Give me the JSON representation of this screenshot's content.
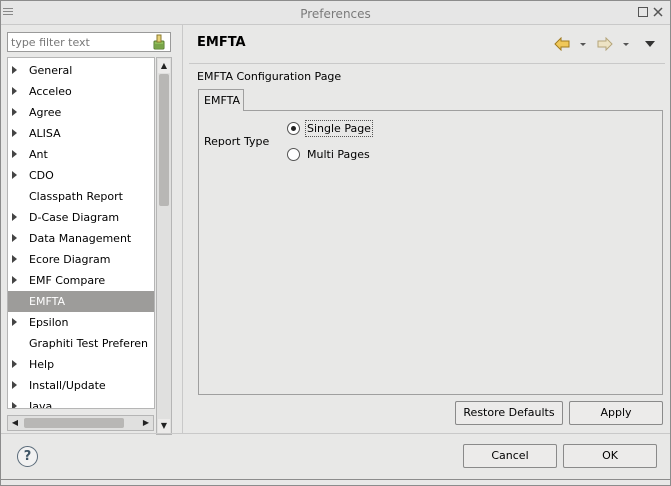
{
  "window": {
    "title": "Preferences"
  },
  "filter": {
    "placeholder": "type filter text"
  },
  "tree": {
    "items": [
      {
        "label": "General",
        "expandable": true
      },
      {
        "label": "Acceleo",
        "expandable": true
      },
      {
        "label": "Agree",
        "expandable": true
      },
      {
        "label": "ALISA",
        "expandable": true
      },
      {
        "label": "Ant",
        "expandable": true
      },
      {
        "label": "CDO",
        "expandable": true
      },
      {
        "label": "Classpath Report",
        "expandable": false
      },
      {
        "label": "D-Case Diagram",
        "expandable": true
      },
      {
        "label": "Data Management",
        "expandable": true
      },
      {
        "label": "Ecore Diagram",
        "expandable": true
      },
      {
        "label": "EMF Compare",
        "expandable": true
      },
      {
        "label": "EMFTA",
        "expandable": false,
        "selected": true
      },
      {
        "label": "Epsilon",
        "expandable": true
      },
      {
        "label": "Graphiti Test Preferen",
        "expandable": false
      },
      {
        "label": "Help",
        "expandable": true
      },
      {
        "label": "Install/Update",
        "expandable": true
      },
      {
        "label": "Java",
        "expandable": true
      }
    ]
  },
  "page": {
    "title": "EMFTA",
    "description": "EMFTA Configuration Page",
    "tab_label": "EMFTA",
    "report_type_label": "Report Type",
    "options": [
      {
        "label": "Single Page",
        "selected": true
      },
      {
        "label": "Multi Pages",
        "selected": false
      }
    ]
  },
  "buttons": {
    "restore_defaults": "Restore Defaults",
    "apply": "Apply",
    "cancel": "Cancel",
    "ok": "OK"
  },
  "icons": {
    "back": "back-arrow-icon",
    "forward": "forward-arrow-icon",
    "menu": "view-menu-icon",
    "help": "help-icon",
    "clear": "clear-filter-icon"
  },
  "colors": {
    "selection": "#9d9c9a",
    "nav_arrow": "#e8b84a"
  }
}
